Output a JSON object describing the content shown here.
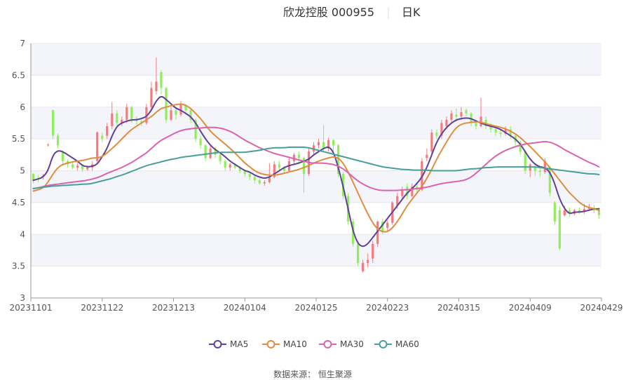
{
  "title": {
    "stock": "欣龙控股 000955",
    "period": "日K"
  },
  "source": "数据来源： 恒生聚源",
  "colors": {
    "up": "#f47a7f",
    "down": "#90ed5b",
    "MA5": "#5f3f9a",
    "MA10": "#df8d3e",
    "MA30": "#d963ae",
    "MA60": "#479e9a",
    "grid_band": "#f4f5fb",
    "axis": "#bbbbbb"
  },
  "chart_data": {
    "type": "candlestick",
    "ylim": [
      3,
      7
    ],
    "y_ticks": [
      3,
      3.5,
      4,
      4.5,
      5,
      5.5,
      6,
      6.5,
      7
    ],
    "x_ticks": [
      "20231101",
      "20231122",
      "20231213",
      "20240104",
      "20240125",
      "20240223",
      "20240315",
      "20240409",
      "20240429"
    ],
    "grid": true,
    "legend_position": "bottom",
    "legend": [
      "MA5",
      "MA10",
      "MA30",
      "MA60"
    ],
    "dates": [
      "20231101",
      "20231102",
      "20231103",
      "20231106",
      "20231107",
      "20231108",
      "20231109",
      "20231110",
      "20231113",
      "20231114",
      "20231115",
      "20231116",
      "20231117",
      "20231120",
      "20231121",
      "20231122",
      "20231123",
      "20231124",
      "20231127",
      "20231128",
      "20231129",
      "20231130",
      "20231201",
      "20231204",
      "20231205",
      "20231206",
      "20231207",
      "20231208",
      "20231211",
      "20231212",
      "20231213",
      "20231214",
      "20231215",
      "20231218",
      "20231219",
      "20231220",
      "20231221",
      "20231222",
      "20231225",
      "20231226",
      "20231227",
      "20231228",
      "20231229",
      "20240102",
      "20240103",
      "20240104",
      "20240105",
      "20240108",
      "20240109",
      "20240110",
      "20240111",
      "20240112",
      "20240115",
      "20240116",
      "20240117",
      "20240118",
      "20240119",
      "20240122",
      "20240123",
      "20240124",
      "20240125",
      "20240126",
      "20240129",
      "20240130",
      "20240131",
      "20240201",
      "20240202",
      "20240205",
      "20240206",
      "20240207",
      "20240208",
      "20240219",
      "20240220",
      "20240221",
      "20240222",
      "20240223",
      "20240226",
      "20240227",
      "20240228",
      "20240229",
      "20240301",
      "20240304",
      "20240305",
      "20240306",
      "20240307",
      "20240308",
      "20240311",
      "20240312",
      "20240313",
      "20240314",
      "20240315",
      "20240318",
      "20240319",
      "20240320",
      "20240321",
      "20240322",
      "20240325",
      "20240326",
      "20240327",
      "20240328",
      "20240329",
      "20240401",
      "20240402",
      "20240403",
      "20240408",
      "20240409",
      "20240410",
      "20240411",
      "20240412",
      "20240415",
      "20240416",
      "20240417",
      "20240418",
      "20240419",
      "20240422",
      "20240423",
      "20240424",
      "20240425",
      "20240426",
      "20240429"
    ],
    "ohlc": [
      [
        4.95,
        4.85,
        4.96,
        4.8
      ],
      [
        4.88,
        4.86,
        4.93,
        4.82
      ],
      [
        4.9,
        4.92,
        4.95,
        4.86
      ],
      [
        5.4,
        5.41,
        5.43,
        5.38
      ],
      [
        5.95,
        5.55,
        5.96,
        5.5
      ],
      [
        5.55,
        5.4,
        5.58,
        5.35
      ],
      [
        5.3,
        5.15,
        5.32,
        5.1
      ],
      [
        5.15,
        5.1,
        5.18,
        5.05
      ],
      [
        5.1,
        5.05,
        5.14,
        5.02
      ],
      [
        5.05,
        5.08,
        5.12,
        5.0
      ],
      [
        5.08,
        5.02,
        5.1,
        4.98
      ],
      [
        5.02,
        5.05,
        5.08,
        5.0
      ],
      [
        5.05,
        5.1,
        5.15,
        5.0
      ],
      [
        5.15,
        5.6,
        5.62,
        5.12
      ],
      [
        5.55,
        5.5,
        5.6,
        5.45
      ],
      [
        5.55,
        5.7,
        5.75,
        5.5
      ],
      [
        5.7,
        5.9,
        6.08,
        5.65
      ],
      [
        5.9,
        5.75,
        5.95,
        5.7
      ],
      [
        5.75,
        5.8,
        5.85,
        5.7
      ],
      [
        5.8,
        6.0,
        6.05,
        5.75
      ],
      [
        6.0,
        5.8,
        6.02,
        5.75
      ],
      [
        5.8,
        5.78,
        5.85,
        5.72
      ],
      [
        5.78,
        5.75,
        5.8,
        5.7
      ],
      [
        5.75,
        6.0,
        6.05,
        5.72
      ],
      [
        6.0,
        6.3,
        6.4,
        5.95
      ],
      [
        6.25,
        6.4,
        6.78,
        6.2
      ],
      [
        6.55,
        6.3,
        6.58,
        6.2
      ],
      [
        6.3,
        5.8,
        6.32,
        5.75
      ],
      [
        5.8,
        5.95,
        6.0,
        5.78
      ],
      [
        5.95,
        5.88,
        5.98,
        5.8
      ],
      [
        5.88,
        6.05,
        6.1,
        5.85
      ],
      [
        6.02,
        5.95,
        6.05,
        5.9
      ],
      [
        5.95,
        5.8,
        5.98,
        5.75
      ],
      [
        5.8,
        5.5,
        5.82,
        5.45
      ],
      [
        5.5,
        5.4,
        5.55,
        5.35
      ],
      [
        5.4,
        5.2,
        5.42,
        5.15
      ],
      [
        5.2,
        5.35,
        5.4,
        5.18
      ],
      [
        5.35,
        5.25,
        5.38,
        5.2
      ],
      [
        5.25,
        5.15,
        5.28,
        5.1
      ],
      [
        5.15,
        5.05,
        5.18,
        5.0
      ],
      [
        5.05,
        5.1,
        5.12,
        5.0
      ],
      [
        5.1,
        5.05,
        5.12,
        5.02
      ],
      [
        5.05,
        5.0,
        5.08,
        4.96
      ],
      [
        5.0,
        4.95,
        5.02,
        4.9
      ],
      [
        4.95,
        4.9,
        4.98,
        4.85
      ],
      [
        4.9,
        4.85,
        4.92,
        4.8
      ],
      [
        4.85,
        4.8,
        4.88,
        4.78
      ],
      [
        4.8,
        4.82,
        4.85,
        4.76
      ],
      [
        4.82,
        4.9,
        5.12,
        4.8
      ],
      [
        4.9,
        5.1,
        5.15,
        4.88
      ],
      [
        5.1,
        5.05,
        5.15,
        5.0
      ],
      [
        5.05,
        5.0,
        5.08,
        4.95
      ],
      [
        5.0,
        5.15,
        5.2,
        4.98
      ],
      [
        5.15,
        5.25,
        5.28,
        5.1
      ],
      [
        5.25,
        5.2,
        5.3,
        5.1
      ],
      [
        5.2,
        4.95,
        5.22,
        4.65
      ],
      [
        4.95,
        5.3,
        5.35,
        4.92
      ],
      [
        5.3,
        5.4,
        5.45,
        5.25
      ],
      [
        5.4,
        5.45,
        5.5,
        5.35
      ],
      [
        5.45,
        5.35,
        5.72,
        5.3
      ],
      [
        5.35,
        5.48,
        5.52,
        5.3
      ],
      [
        5.48,
        5.4,
        5.5,
        5.3
      ],
      [
        5.4,
        4.95,
        5.42,
        4.9
      ],
      [
        4.95,
        4.6,
        4.98,
        4.55
      ],
      [
        4.6,
        4.2,
        4.65,
        4.15
      ],
      [
        4.2,
        3.85,
        4.25,
        3.8
      ],
      [
        3.85,
        3.55,
        3.9,
        3.5
      ],
      [
        3.42,
        3.55,
        3.6,
        3.4
      ],
      [
        3.55,
        3.6,
        3.7,
        3.48
      ],
      [
        3.62,
        3.85,
        3.9,
        3.55
      ],
      [
        3.85,
        4.2,
        4.22,
        3.8
      ],
      [
        4.2,
        4.05,
        4.25,
        4.0
      ],
      [
        4.1,
        4.18,
        4.22,
        4.05
      ],
      [
        4.18,
        4.5,
        4.52,
        4.15
      ],
      [
        4.45,
        4.6,
        4.65,
        4.4
      ],
      [
        4.6,
        4.7,
        4.75,
        4.55
      ],
      [
        4.75,
        4.6,
        4.8,
        4.55
      ],
      [
        4.6,
        4.75,
        4.8,
        4.58
      ],
      [
        4.75,
        4.7,
        4.8,
        4.65
      ],
      [
        4.7,
        5.15,
        5.2,
        4.68
      ],
      [
        5.2,
        5.25,
        5.35,
        5.15
      ],
      [
        5.3,
        5.6,
        5.65,
        5.25
      ],
      [
        5.6,
        5.55,
        5.65,
        5.5
      ],
      [
        5.55,
        5.75,
        5.8,
        5.5
      ],
      [
        5.7,
        5.8,
        5.85,
        5.65
      ],
      [
        5.8,
        5.9,
        5.95,
        5.75
      ],
      [
        5.88,
        5.85,
        5.98,
        5.8
      ],
      [
        5.85,
        5.92,
        6.0,
        5.8
      ],
      [
        5.95,
        5.9,
        5.98,
        5.85
      ],
      [
        5.9,
        5.75,
        5.92,
        5.7
      ],
      [
        5.75,
        5.7,
        5.8,
        5.65
      ],
      [
        5.7,
        5.85,
        6.15,
        5.68
      ],
      [
        5.8,
        5.7,
        5.85,
        5.65
      ],
      [
        5.7,
        5.65,
        5.75,
        5.6
      ],
      [
        5.65,
        5.6,
        5.7,
        5.55
      ],
      [
        5.6,
        5.58,
        5.65,
        5.52
      ],
      [
        5.58,
        5.65,
        5.7,
        5.55
      ],
      [
        5.65,
        5.55,
        5.7,
        5.5
      ],
      [
        5.55,
        5.45,
        5.58,
        5.4
      ],
      [
        5.45,
        5.3,
        5.48,
        5.25
      ],
      [
        5.3,
        5.0,
        5.32,
        4.95
      ],
      [
        5.0,
        5.1,
        5.12,
        4.9
      ],
      [
        5.05,
        5.0,
        5.1,
        4.92
      ],
      [
        5.0,
        4.98,
        5.05,
        4.9
      ],
      [
        4.98,
        5.15,
        5.2,
        4.95
      ],
      [
        5.05,
        4.65,
        5.08,
        4.6
      ],
      [
        4.5,
        4.2,
        4.52,
        4.15
      ],
      [
        4.38,
        3.78,
        4.45,
        3.75
      ],
      [
        4.3,
        4.38,
        4.45,
        4.28
      ],
      [
        4.38,
        4.32,
        4.42,
        4.28
      ],
      [
        4.32,
        4.38,
        4.4,
        4.3
      ],
      [
        4.38,
        4.35,
        4.42,
        4.32
      ],
      [
        4.35,
        4.4,
        4.48,
        4.32
      ],
      [
        4.4,
        4.42,
        4.48,
        4.38
      ],
      [
        4.42,
        4.38,
        4.46,
        4.33
      ],
      [
        4.38,
        4.3,
        4.42,
        4.25
      ]
    ],
    "series": [
      {
        "name": "MA5",
        "values": [
          4.85,
          4.87,
          4.9,
          5.0,
          5.25,
          5.32,
          5.3,
          5.25,
          5.2,
          5.15,
          5.08,
          5.06,
          5.07,
          5.1,
          5.22,
          5.35,
          5.55,
          5.7,
          5.75,
          5.78,
          5.8,
          5.8,
          5.82,
          5.85,
          5.95,
          6.1,
          6.18,
          6.12,
          6.05,
          5.98,
          5.95,
          5.9,
          5.85,
          5.75,
          5.62,
          5.5,
          5.4,
          5.33,
          5.28,
          5.22,
          5.15,
          5.1,
          5.05,
          5.0,
          4.98,
          4.93,
          4.9,
          4.88,
          4.9,
          4.95,
          5.0,
          5.05,
          5.08,
          5.1,
          5.12,
          5.15,
          5.18,
          5.25,
          5.3,
          5.35,
          5.38,
          5.3,
          5.05,
          4.75,
          4.4,
          4.05,
          3.85,
          3.8,
          3.85,
          3.95,
          4.05,
          4.15,
          4.25,
          4.35,
          4.45,
          4.55,
          4.65,
          4.72,
          4.8,
          4.9,
          5.05,
          5.25,
          5.45,
          5.58,
          5.68,
          5.75,
          5.8,
          5.82,
          5.83,
          5.82,
          5.78,
          5.75,
          5.72,
          5.7,
          5.68,
          5.65,
          5.6,
          5.55,
          5.5,
          5.42,
          5.3,
          5.18,
          5.1,
          5.06,
          5.05,
          4.98,
          4.8,
          4.55,
          4.4,
          4.32,
          4.35,
          4.35,
          4.36,
          4.38,
          4.4,
          4.4
        ]
      },
      {
        "name": "MA10",
        "values": [
          4.68,
          4.7,
          4.73,
          4.82,
          4.95,
          5.05,
          5.1,
          5.12,
          5.14,
          5.15,
          5.16,
          5.18,
          5.2,
          5.2,
          5.22,
          5.28,
          5.35,
          5.42,
          5.5,
          5.58,
          5.65,
          5.7,
          5.75,
          5.8,
          5.85,
          5.92,
          5.98,
          6.0,
          6.02,
          6.04,
          6.05,
          6.03,
          5.98,
          5.9,
          5.82,
          5.72,
          5.62,
          5.55,
          5.48,
          5.42,
          5.35,
          5.28,
          5.2,
          5.12,
          5.06,
          5.0,
          4.96,
          4.94,
          4.93,
          4.93,
          4.94,
          4.96,
          4.98,
          5.0,
          5.02,
          5.05,
          5.08,
          5.12,
          5.15,
          5.18,
          5.2,
          5.22,
          5.2,
          5.12,
          4.98,
          4.82,
          4.65,
          4.48,
          4.32,
          4.18,
          4.08,
          4.04,
          4.04,
          4.1,
          4.2,
          4.32,
          4.45,
          4.55,
          4.65,
          4.75,
          4.88,
          5.02,
          5.18,
          5.32,
          5.45,
          5.58,
          5.68,
          5.73,
          5.75,
          5.76,
          5.77,
          5.76,
          5.74,
          5.72,
          5.7,
          5.68,
          5.66,
          5.62,
          5.58,
          5.52,
          5.45,
          5.38,
          5.3,
          5.22,
          5.14,
          5.05,
          4.95,
          4.85,
          4.75,
          4.65,
          4.58,
          4.5,
          4.45,
          4.42,
          4.4,
          4.38
        ]
      },
      {
        "name": "MA30",
        "values": [
          4.72,
          4.73,
          4.75,
          4.77,
          4.78,
          4.79,
          4.8,
          4.81,
          4.82,
          4.83,
          4.84,
          4.85,
          4.87,
          4.89,
          4.92,
          4.96,
          4.99,
          5.02,
          5.05,
          5.09,
          5.13,
          5.18,
          5.23,
          5.28,
          5.35,
          5.42,
          5.48,
          5.52,
          5.56,
          5.6,
          5.63,
          5.65,
          5.66,
          5.67,
          5.67,
          5.68,
          5.68,
          5.68,
          5.67,
          5.65,
          5.62,
          5.58,
          5.53,
          5.48,
          5.44,
          5.4,
          5.36,
          5.33,
          5.3,
          5.27,
          5.25,
          5.23,
          5.21,
          5.19,
          5.17,
          5.15,
          5.13,
          5.12,
          5.12,
          5.12,
          5.11,
          5.1,
          5.07,
          5.03,
          4.97,
          4.9,
          4.84,
          4.79,
          4.75,
          4.72,
          4.7,
          4.69,
          4.69,
          4.69,
          4.69,
          4.7,
          4.7,
          4.71,
          4.72,
          4.73,
          4.74,
          4.76,
          4.78,
          4.8,
          4.81,
          4.82,
          4.83,
          4.84,
          4.86,
          4.9,
          4.96,
          5.03,
          5.1,
          5.17,
          5.23,
          5.28,
          5.32,
          5.35,
          5.38,
          5.4,
          5.42,
          5.43,
          5.44,
          5.45,
          5.46,
          5.45,
          5.42,
          5.38,
          5.33,
          5.29,
          5.25,
          5.21,
          5.17,
          5.13,
          5.1,
          5.06
        ]
      },
      {
        "name": "MA60",
        "values": [
          4.72,
          4.73,
          4.74,
          4.75,
          4.76,
          4.76,
          4.77,
          4.77,
          4.78,
          4.78,
          4.79,
          4.79,
          4.8,
          4.82,
          4.84,
          4.86,
          4.88,
          4.91,
          4.93,
          4.96,
          4.99,
          5.02,
          5.05,
          5.08,
          5.1,
          5.12,
          5.14,
          5.16,
          5.18,
          5.19,
          5.21,
          5.22,
          5.23,
          5.24,
          5.25,
          5.26,
          5.27,
          5.28,
          5.29,
          5.29,
          5.29,
          5.29,
          5.29,
          5.29,
          5.3,
          5.31,
          5.32,
          5.34,
          5.35,
          5.36,
          5.36,
          5.36,
          5.37,
          5.37,
          5.37,
          5.37,
          5.36,
          5.34,
          5.32,
          5.3,
          5.28,
          5.26,
          5.24,
          5.22,
          5.2,
          5.18,
          5.16,
          5.14,
          5.12,
          5.1,
          5.08,
          5.06,
          5.05,
          5.04,
          5.03,
          5.02,
          5.02,
          5.01,
          5.01,
          5.01,
          5.01,
          5.0,
          5.0,
          5.0,
          5.0,
          5.0,
          5.0,
          5.01,
          5.02,
          5.03,
          5.03,
          5.04,
          5.05,
          5.05,
          5.06,
          5.06,
          5.06,
          5.06,
          5.06,
          5.06,
          5.06,
          5.06,
          5.06,
          5.05,
          5.04,
          5.03,
          5.02,
          5.01,
          5.0,
          4.99,
          4.98,
          4.97,
          4.96,
          4.95,
          4.95,
          4.94
        ]
      }
    ]
  }
}
